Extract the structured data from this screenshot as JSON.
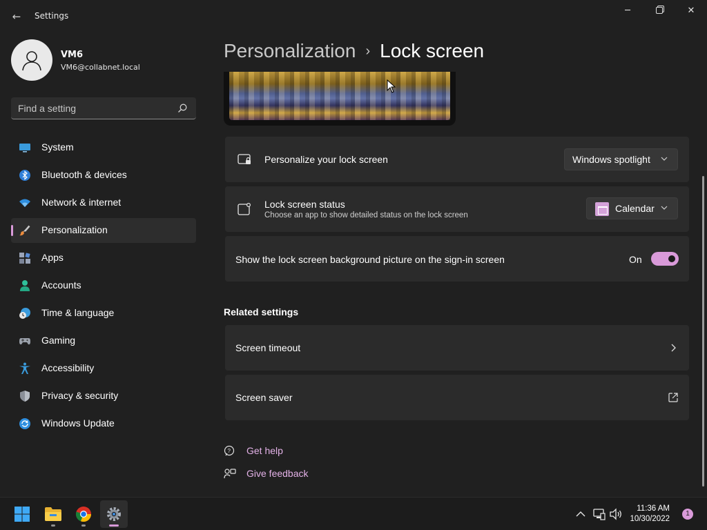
{
  "window": {
    "app_title": "Settings",
    "back_glyph": "←",
    "minimize_glyph": "─",
    "close_glyph": "✕"
  },
  "user": {
    "name": "VM6",
    "email": "VM6@collabnet.local"
  },
  "search": {
    "placeholder": "Find a setting"
  },
  "sidebar": {
    "items": [
      {
        "label": "System",
        "icon": "system-icon"
      },
      {
        "label": "Bluetooth & devices",
        "icon": "bluetooth-icon"
      },
      {
        "label": "Network & internet",
        "icon": "wifi-icon"
      },
      {
        "label": "Personalization",
        "icon": "brush-icon",
        "active": true
      },
      {
        "label": "Apps",
        "icon": "apps-icon"
      },
      {
        "label": "Accounts",
        "icon": "accounts-icon"
      },
      {
        "label": "Time & language",
        "icon": "clock-globe-icon"
      },
      {
        "label": "Gaming",
        "icon": "gamepad-icon"
      },
      {
        "label": "Accessibility",
        "icon": "accessibility-icon"
      },
      {
        "label": "Privacy & security",
        "icon": "shield-icon"
      },
      {
        "label": "Windows Update",
        "icon": "update-icon"
      }
    ]
  },
  "breadcrumb": {
    "parent": "Personalization",
    "separator": "›",
    "current": "Lock screen"
  },
  "settings": {
    "personalize": {
      "title": "Personalize your lock screen",
      "value": "Windows spotlight"
    },
    "status": {
      "title": "Lock screen status",
      "subtitle": "Choose an app to show detailed status on the lock screen",
      "value": "Calendar"
    },
    "signin_picture": {
      "title": "Show the lock screen background picture on the sign-in screen",
      "state": "On",
      "enabled": true
    }
  },
  "related": {
    "title": "Related settings",
    "screen_timeout": "Screen timeout",
    "screen_saver": "Screen saver"
  },
  "help": {
    "get_help": "Get help",
    "give_feedback": "Give feedback"
  },
  "taskbar": {
    "apps": [
      "start-icon",
      "file-explorer-icon",
      "chrome-icon",
      "settings-icon"
    ],
    "time": "11:36 AM",
    "date": "10/30/2022",
    "notification_count": "1"
  },
  "colors": {
    "accent": "#d99ad9",
    "background": "#202020",
    "card": "#2b2b2b"
  }
}
